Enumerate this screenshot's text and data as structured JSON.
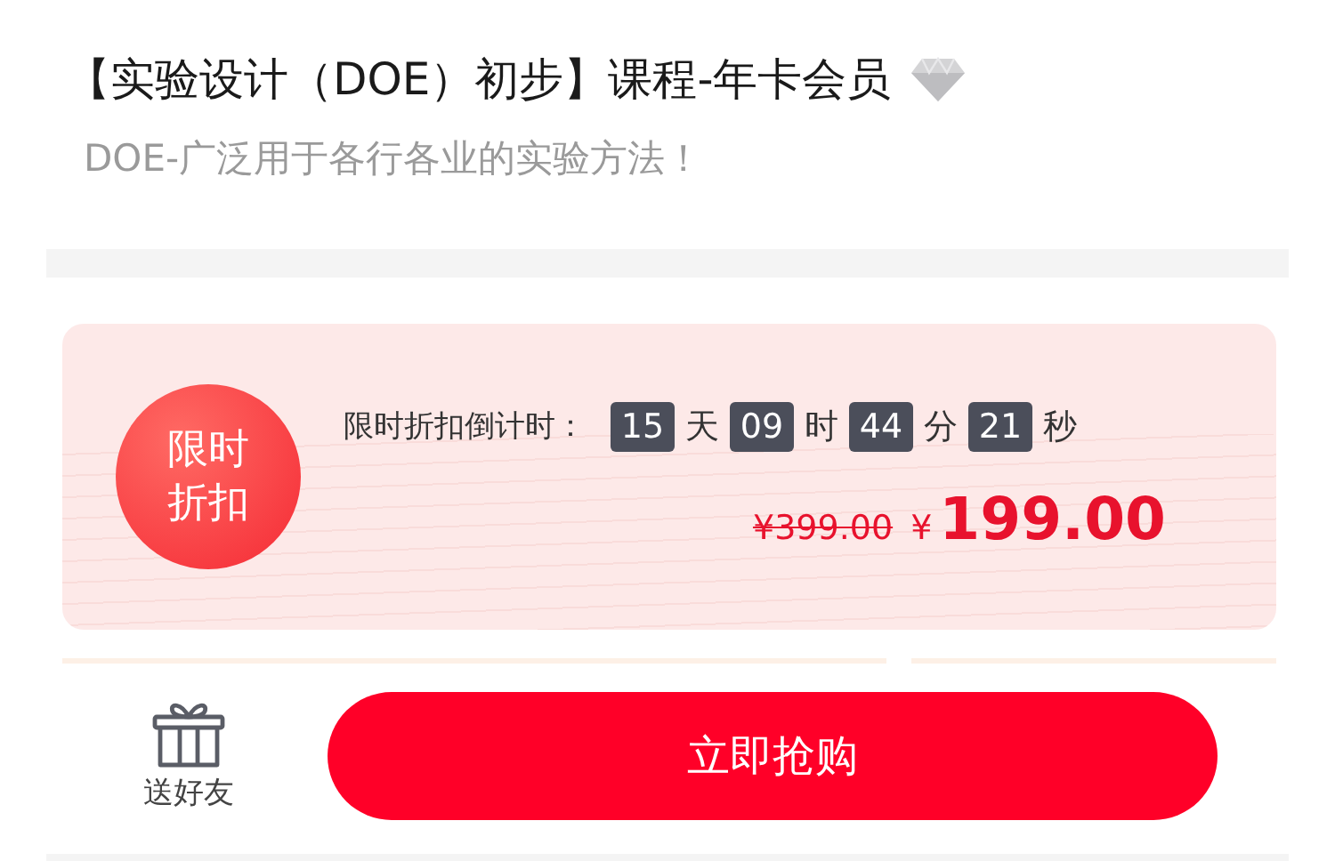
{
  "title": "【实验设计（DOE）初步】课程-年卡会员",
  "subtitle": "DOE-广泛用于各行各业的实验方法！",
  "promo": {
    "badge_lines": [
      "限时",
      "折扣"
    ],
    "countdown_label": "限时折扣倒计时：",
    "countdown": [
      {
        "value": "15",
        "unit": "天"
      },
      {
        "value": "09",
        "unit": "时"
      },
      {
        "value": "44",
        "unit": "分"
      },
      {
        "value": "21",
        "unit": "秒"
      }
    ],
    "original_price": "¥399.00",
    "currency": "¥",
    "price": "199.00"
  },
  "bottom_bar": {
    "gift_label": "送好友",
    "buy_button": "立即抢购"
  }
}
